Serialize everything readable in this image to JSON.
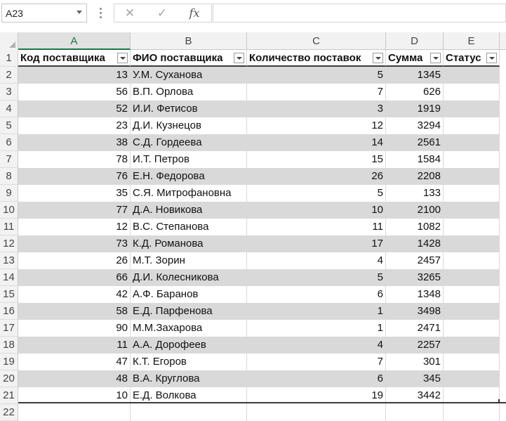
{
  "formula_bar": {
    "name_box": "A23",
    "cancel_icon": "✕",
    "enter_icon": "✓",
    "fx_label": "fx",
    "formula_value": ""
  },
  "columns": [
    "A",
    "B",
    "C",
    "D",
    "E"
  ],
  "row_numbers": [
    "1",
    "2",
    "3",
    "4",
    "5",
    "6",
    "7",
    "8",
    "9",
    "10",
    "11",
    "12",
    "13",
    "14",
    "15",
    "16",
    "17",
    "18",
    "19",
    "20",
    "21",
    "22"
  ],
  "table": {
    "headers": [
      "Код поставщика",
      "ФИО поставщика",
      "Количество поставок",
      "Сумма",
      "Статус"
    ],
    "rows": [
      [
        "13",
        "У.М. Суханова",
        "5",
        "1345",
        ""
      ],
      [
        "56",
        "В.П. Орлова",
        "7",
        "626",
        ""
      ],
      [
        "52",
        "И.И. Фетисов",
        "3",
        "1919",
        ""
      ],
      [
        "23",
        "Д.И. Кузнецов",
        "12",
        "3294",
        ""
      ],
      [
        "38",
        "С.Д. Гордеева",
        "14",
        "2561",
        ""
      ],
      [
        "78",
        "И.Т. Петров",
        "15",
        "1584",
        ""
      ],
      [
        "76",
        "Е.Н. Федорова",
        "26",
        "2208",
        ""
      ],
      [
        "35",
        "С.Я. Митрофановна",
        "5",
        "133",
        ""
      ],
      [
        "77",
        "Д.А. Новикова",
        "10",
        "2100",
        ""
      ],
      [
        "12",
        "В.С. Степанова",
        "11",
        "1082",
        ""
      ],
      [
        "73",
        "К.Д. Романова",
        "17",
        "1428",
        ""
      ],
      [
        "26",
        "М.Т. Зорин",
        "4",
        "2457",
        ""
      ],
      [
        "66",
        "Д.И. Колесникова",
        "5",
        "3265",
        ""
      ],
      [
        "42",
        "А.Ф. Баранов",
        "6",
        "1348",
        ""
      ],
      [
        "58",
        "Е.Д. Парфенова",
        "1",
        "3498",
        ""
      ],
      [
        "90",
        "М.М.Захарова",
        "1",
        "2471",
        ""
      ],
      [
        "11",
        "А.А. Дорофеев",
        "4",
        "2257",
        ""
      ],
      [
        "47",
        "К.Т. Егоров",
        "7",
        "301",
        ""
      ],
      [
        "48",
        "В.А. Круглова",
        "6",
        "345",
        ""
      ],
      [
        "10",
        "Е.Д. Волкова",
        "19",
        "3442",
        ""
      ]
    ]
  },
  "colors": {
    "band": "#d9d9d9",
    "header_bg": "#f2f2f2",
    "selected_col": "#217346"
  }
}
